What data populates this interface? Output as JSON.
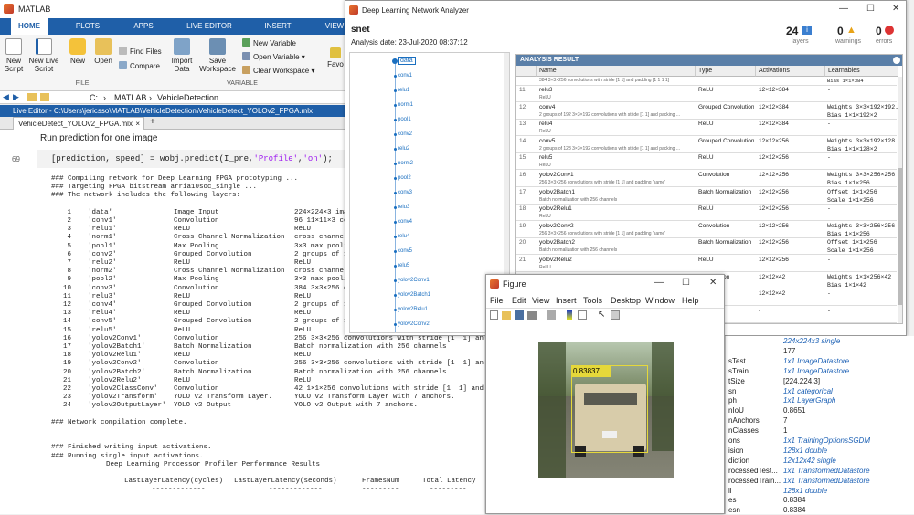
{
  "matlab": {
    "title": "MATLAB",
    "tabs": [
      "HOME",
      "PLOTS",
      "APPS",
      "LIVE EDITOR",
      "INSERT",
      "VIEW"
    ],
    "ribbon": {
      "new_script": "New Script",
      "new_live_script": "New Live Script",
      "new": "New",
      "open": "Open",
      "find_files": "Find Files",
      "compare": "Compare",
      "file_group": "FILE",
      "import_data": "Import Data",
      "save_workspace": "Save Workspace",
      "new_variable": "New Variable",
      "open_variable": "Open Variable",
      "clear_workspace": "Clear Workspace",
      "variable_group": "VARIABLE",
      "favorites": "Favo"
    },
    "path": [
      "C:",
      "MATLAB",
      "VehicleDetection"
    ],
    "editor_title": "Live Editor - C:\\Users\\jericsso\\MATLAB\\VehicleDetection\\VehicleDetect_YOLOv2_FPGA.mlx",
    "doc_tab": "VehicleDetect_YOLOv2_FPGA.mlx",
    "section_heading": "Run prediction for one image",
    "line_number": "69",
    "code_line": {
      "p1": "[prediction, speed] = wobj.predict(I_pre,",
      "s1": "'Profile'",
      "p2": ",",
      "s2": "'on'",
      "p3": ");"
    },
    "output_head": [
      "### Compiling network for Deep Learning FPGA prototyping ...",
      "### Targeting FPGA bitstream arria10soc_single ...",
      "### The network includes the following layers:"
    ],
    "layers": [
      [
        "1",
        "'data'",
        "Image Input",
        "224×224×3 ima"
      ],
      [
        "2",
        "'conv1'",
        "Convolution",
        "96 11×11×3 co"
      ],
      [
        "3",
        "'relu1'",
        "ReLU",
        "ReLU"
      ],
      [
        "4",
        "'norm1'",
        "Cross Channel Normalization",
        "cross channel"
      ],
      [
        "5",
        "'pool1'",
        "Max Pooling",
        "3×3 max pooli"
      ],
      [
        "6",
        "'conv2'",
        "Grouped Convolution",
        "2 groups of 1"
      ],
      [
        "7",
        "'relu2'",
        "ReLU",
        "ReLU"
      ],
      [
        "8",
        "'norm2'",
        "Cross Channel Normalization",
        "cross channel"
      ],
      [
        "9",
        "'pool2'",
        "Max Pooling",
        "3×3 max pooli"
      ],
      [
        "10",
        "'conv3'",
        "Convolution",
        "384 3×3×256 c"
      ],
      [
        "11",
        "'relu3'",
        "ReLU",
        "ReLU"
      ],
      [
        "12",
        "'conv4'",
        "Grouped Convolution",
        "2 groups of 1"
      ],
      [
        "13",
        "'relu4'",
        "ReLU",
        "ReLU"
      ],
      [
        "14",
        "'conv5'",
        "Grouped Convolution",
        "2 groups of 1"
      ],
      [
        "15",
        "'relu5'",
        "ReLU",
        "ReLU"
      ],
      [
        "16",
        "'yolov2Conv1'",
        "Convolution",
        "256 3×3×256 convolutions with stride [1  1] and"
      ],
      [
        "17",
        "'yolov2Batch1'",
        "Batch Normalization",
        "Batch normalization with 256 channels"
      ],
      [
        "18",
        "'yolov2Relu1'",
        "ReLU",
        "ReLU"
      ],
      [
        "19",
        "'yolov2Conv2'",
        "Convolution",
        "256 3×3×256 convolutions with stride [1  1] and"
      ],
      [
        "20",
        "'yolov2Batch2'",
        "Batch Normalization",
        "Batch normalization with 256 channels"
      ],
      [
        "21",
        "'yolov2Relu2'",
        "ReLU",
        "ReLU"
      ],
      [
        "22",
        "'yolov2ClassConv'",
        "Convolution",
        "42 1×1×256 convolutions with stride [1  1] and p"
      ],
      [
        "23",
        "'yolov2Transform'",
        "YOLO v2 Transform Layer.",
        "YOLO v2 Transform Layer with 7 anchors."
      ],
      [
        "24",
        "'yolov2OutputLayer'",
        "YOLO v2 Output",
        "YOLO v2 Output with 7 anchors."
      ]
    ],
    "compile_done": "### Network compilation complete.",
    "finished_writing": "### Finished writing input activations.",
    "running": "### Running single input activations.",
    "profiler_title": "Deep Learning Processor Profiler Performance Results",
    "profiler_headers": [
      "LastLayerLatency(cycles)",
      "LastLayerLatency(seconds)",
      "FramesNum",
      "Total Latency"
    ]
  },
  "dlna": {
    "title": "Deep Learning Network Analyzer",
    "network": "snet",
    "analysis_date": "Analysis date: 23-Jul-2020 08:37:12",
    "layers_count": "24",
    "layers_label": "layers",
    "warnings_count": "0",
    "warnings_label": "warnings",
    "errors_count": "0",
    "errors_label": "errors",
    "graph_nodes": [
      "data",
      "conv1",
      "relu1",
      "norm1",
      "pool1",
      "conv2",
      "relu2",
      "norm2",
      "pool2",
      "conv3",
      "relu3",
      "conv4",
      "relu4",
      "conv5",
      "relu5",
      "yolov2Conv1",
      "yolov2Batch1",
      "yolov2Relu1",
      "yolov2Conv2"
    ],
    "result_title": "ANALYSIS RESULT",
    "columns": [
      "Name",
      "Type",
      "Activations",
      "Learnables"
    ],
    "top_partial": {
      "desc": "384 3×3×256 convolutions with stride [1 1] and padding [1 1 1 1]",
      "learn": "Bias    1×1×384"
    },
    "rows": [
      {
        "num": "11",
        "name": "relu3",
        "sub": "ReLU",
        "type": "ReLU",
        "act": "12×12×384",
        "learn1": "-",
        "learn2": ""
      },
      {
        "num": "12",
        "name": "conv4",
        "sub": "2 groups of 192 3×3×192 convolutions with stride [1 1] and packing ...",
        "type": "Grouped Convolution",
        "act": "12×12×384",
        "learn1": "Weights  3×3×192×192...",
        "learn2": "Bias     1×1×192×2"
      },
      {
        "num": "13",
        "name": "relu4",
        "sub": "ReLU",
        "type": "ReLU",
        "act": "12×12×384",
        "learn1": "-",
        "learn2": ""
      },
      {
        "num": "14",
        "name": "conv5",
        "sub": "2 groups of 128 3×3×192 convolutions with stride [1 1] and packing ...",
        "type": "Grouped Convolution",
        "act": "12×12×256",
        "learn1": "Weights  3×3×192×128...",
        "learn2": "Bias     1×1×128×2"
      },
      {
        "num": "15",
        "name": "relu5",
        "sub": "ReLU",
        "type": "ReLU",
        "act": "12×12×256",
        "learn1": "-",
        "learn2": ""
      },
      {
        "num": "16",
        "name": "yolov2Conv1",
        "sub": "256 3×3×256 convolutions with stride [1 1] and padding 'same'",
        "type": "Convolution",
        "act": "12×12×256",
        "learn1": "Weights  3×3×256×256",
        "learn2": "Bias     1×1×256"
      },
      {
        "num": "17",
        "name": "yolov2Batch1",
        "sub": "Batch normalization with 256 channels",
        "type": "Batch Normalization",
        "act": "12×12×256",
        "learn1": "Offset  1×1×256",
        "learn2": "Scale   1×1×256"
      },
      {
        "num": "18",
        "name": "yolov2Relu1",
        "sub": "ReLU",
        "type": "ReLU",
        "act": "12×12×256",
        "learn1": "-",
        "learn2": ""
      },
      {
        "num": "19",
        "name": "yolov2Conv2",
        "sub": "256 3×3×256 convolutions with stride [1 1] and padding 'same'",
        "type": "Convolution",
        "act": "12×12×256",
        "learn1": "Weights  3×3×256×256",
        "learn2": "Bias     1×1×256"
      },
      {
        "num": "20",
        "name": "yolov2Batch2",
        "sub": "Batch normalization with 256 channels",
        "type": "Batch Normalization",
        "act": "12×12×256",
        "learn1": "Offset  1×1×256",
        "learn2": "Scale   1×1×256"
      },
      {
        "num": "21",
        "name": "yolov2Relu2",
        "sub": "ReLU",
        "type": "ReLU",
        "act": "12×12×256",
        "learn1": "-",
        "learn2": ""
      },
      {
        "num": "22",
        "name": "yolov2ClassConv",
        "sub": "",
        "type": "Convolution",
        "act": "12×12×42",
        "learn1": "Weights  1×1×256×42",
        "learn2": "Bias     1×1×42"
      },
      {
        "num": "23",
        "name": "yolov2Transfor...",
        "sub": "",
        "type": "ransfor...",
        "act": "12×12×42",
        "learn1": "-",
        "learn2": ""
      },
      {
        "num": "24",
        "name": "",
        "sub": "",
        "type": "Output",
        "act": "-",
        "learn1": "-",
        "learn2": ""
      }
    ]
  },
  "figure": {
    "title": "Figure",
    "menu": [
      "File",
      "Edit",
      "View",
      "Insert",
      "Tools",
      "Desktop",
      "Window",
      "Help"
    ],
    "score": "0.83837"
  },
  "workspace": {
    "rows": [
      {
        "name": "",
        "value": "224x224x3 single",
        "link": false
      },
      {
        "name": "",
        "value": "177",
        "link": false
      },
      {
        "name": "sTest",
        "value": "1x1 ImageDatastore",
        "link": true
      },
      {
        "name": "sTrain",
        "value": "1x1 ImageDatastore",
        "link": true
      },
      {
        "name": "tSize",
        "value": "[224,224,3]",
        "link": false
      },
      {
        "name": "sn",
        "value": "1x1 categorical",
        "link": true
      },
      {
        "name": "ph",
        "value": "1x1 LayerGraph",
        "link": true
      },
      {
        "name": "nIoU",
        "value": "0.8651",
        "link": false
      },
      {
        "name": "nAnchors",
        "value": "7",
        "link": false
      },
      {
        "name": "nClasses",
        "value": "1",
        "link": false
      },
      {
        "name": "ons",
        "value": "1x1 TrainingOptionsSGDM",
        "link": true
      },
      {
        "name": "ision",
        "value": "128x1 double",
        "link": true
      },
      {
        "name": "diction",
        "value": "12x12x42 single",
        "link": true
      },
      {
        "name": "rocessedTest...",
        "value": "1x1 TransformedDatastore",
        "link": true
      },
      {
        "name": "rocessedTrain...",
        "value": "1x1 TransformedDatastore",
        "link": true
      },
      {
        "name": "ll",
        "value": "128x1 double",
        "link": true
      },
      {
        "name": "es",
        "value": "0.8384",
        "link": false
      },
      {
        "name": "esn",
        "value": "0.8384",
        "link": false
      }
    ]
  },
  "colors": {
    "matlab_blue": "#1f5fa8",
    "link": "#1a5fb4",
    "string": "#a020f0",
    "box": "#e5d83a"
  }
}
